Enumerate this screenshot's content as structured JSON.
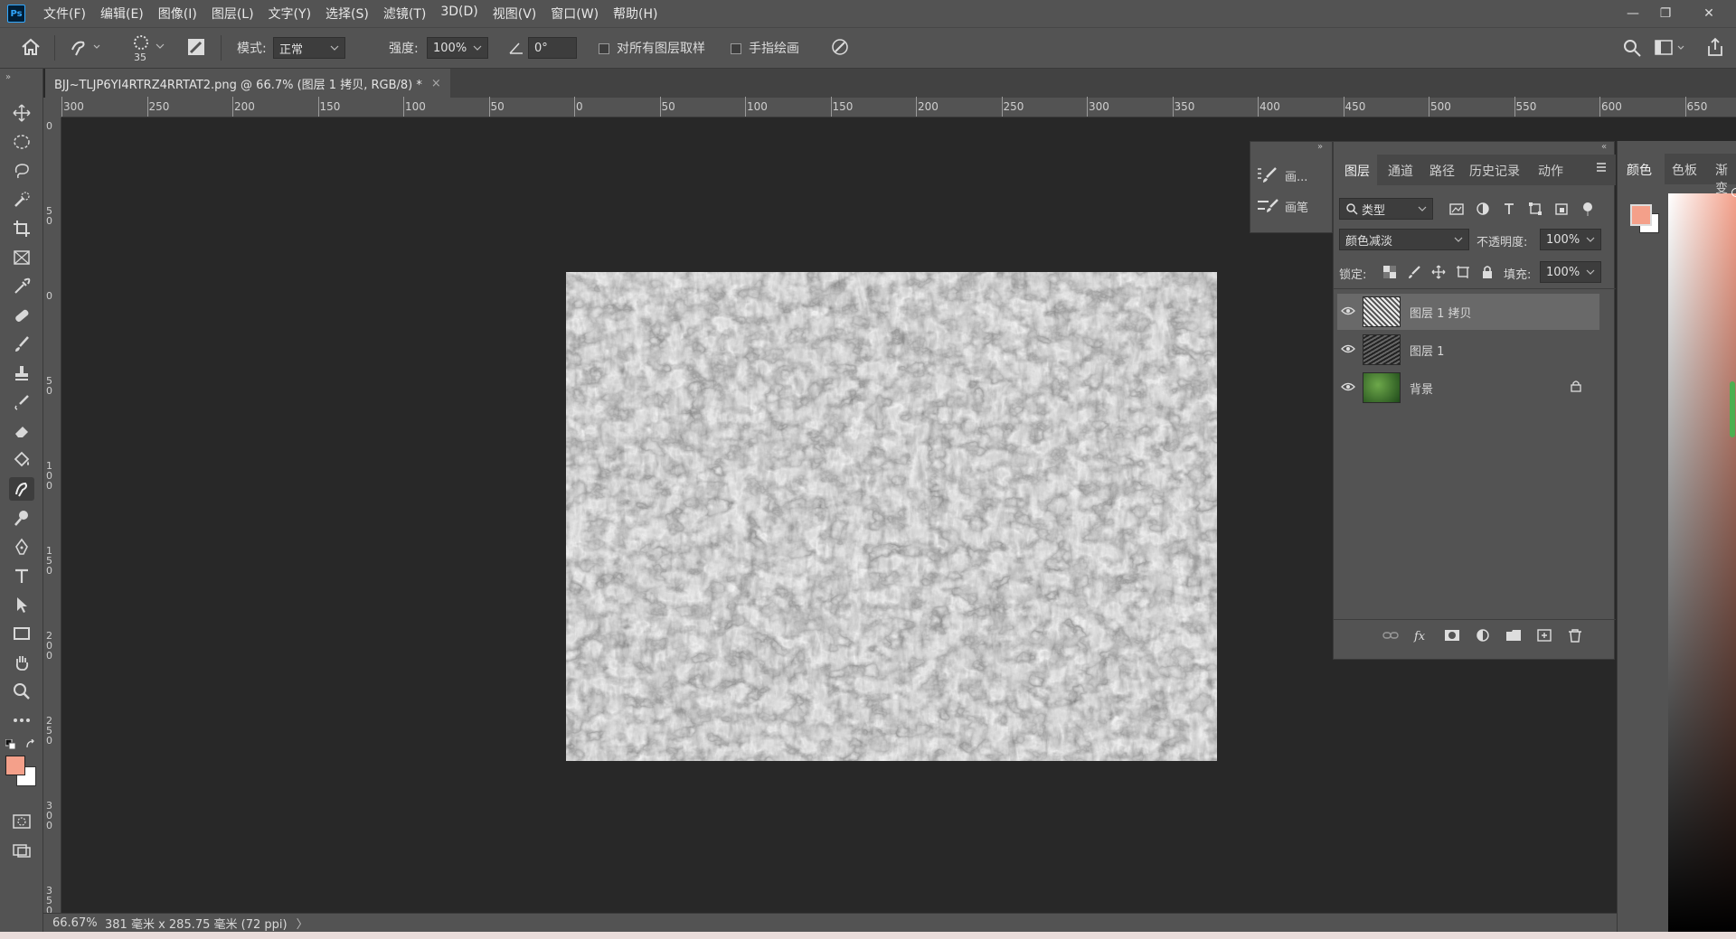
{
  "app": {
    "logo": "Ps"
  },
  "menu": [
    "文件(F)",
    "编辑(E)",
    "图像(I)",
    "图层(L)",
    "文字(Y)",
    "选择(S)",
    "滤镜(T)",
    "3D(D)",
    "视图(V)",
    "窗口(W)",
    "帮助(H)"
  ],
  "window_controls": {
    "minimize": "—",
    "restore": "❐",
    "close": "✕"
  },
  "options": {
    "brush_size": "35",
    "mode_label": "模式:",
    "mode_value": "正常",
    "strength_label": "强度:",
    "strength_value": "100%",
    "angle_value": "0°",
    "sample_all_label": "对所有图层取样",
    "finger_paint_label": "手指绘画"
  },
  "document": {
    "tab_title": "BJJ~TLJP6YI4RTRZ4RRTAT2.png @ 66.7% (图层 1 拷贝, RGB/8) *",
    "close": "×"
  },
  "ruler": {
    "h_ticks": [
      "300",
      "250",
      "200",
      "150",
      "100",
      "50",
      "0",
      "50",
      "100",
      "150",
      "200",
      "250",
      "300",
      "350",
      "400",
      "450",
      "500",
      "550",
      "600",
      "650"
    ],
    "v_ticks": [
      "0",
      "50",
      "0",
      "50",
      "100",
      "150",
      "200",
      "250",
      "300",
      "350"
    ]
  },
  "status": {
    "zoom": "66.67%",
    "size": "381 毫米 x 285.75 毫米 (72 ppi)",
    "arrow": "〉"
  },
  "brush_panel": {
    "items": [
      "画...",
      "画笔"
    ]
  },
  "layers_panel": {
    "tabs": [
      "图层",
      "通道",
      "路径",
      "历史记录",
      "动作"
    ],
    "filter_value": "类型",
    "blend_mode": "颜色减淡",
    "opacity_label": "不透明度:",
    "opacity_value": "100%",
    "lock_label": "锁定:",
    "fill_label": "填充:",
    "fill_value": "100%",
    "layers": [
      {
        "name": "图层 1 拷贝",
        "selected": true,
        "locked": false
      },
      {
        "name": "图层 1",
        "selected": false,
        "locked": false
      },
      {
        "name": "背景",
        "selected": false,
        "locked": true
      }
    ]
  },
  "color_panel": {
    "tabs": [
      "颜色",
      "色板",
      "渐变"
    ],
    "foreground": "#f4a08a",
    "background": "#ffffff"
  },
  "colors": {
    "ui_bg": "#535353",
    "workspace": "#282828",
    "accent_selected": "#696969"
  }
}
